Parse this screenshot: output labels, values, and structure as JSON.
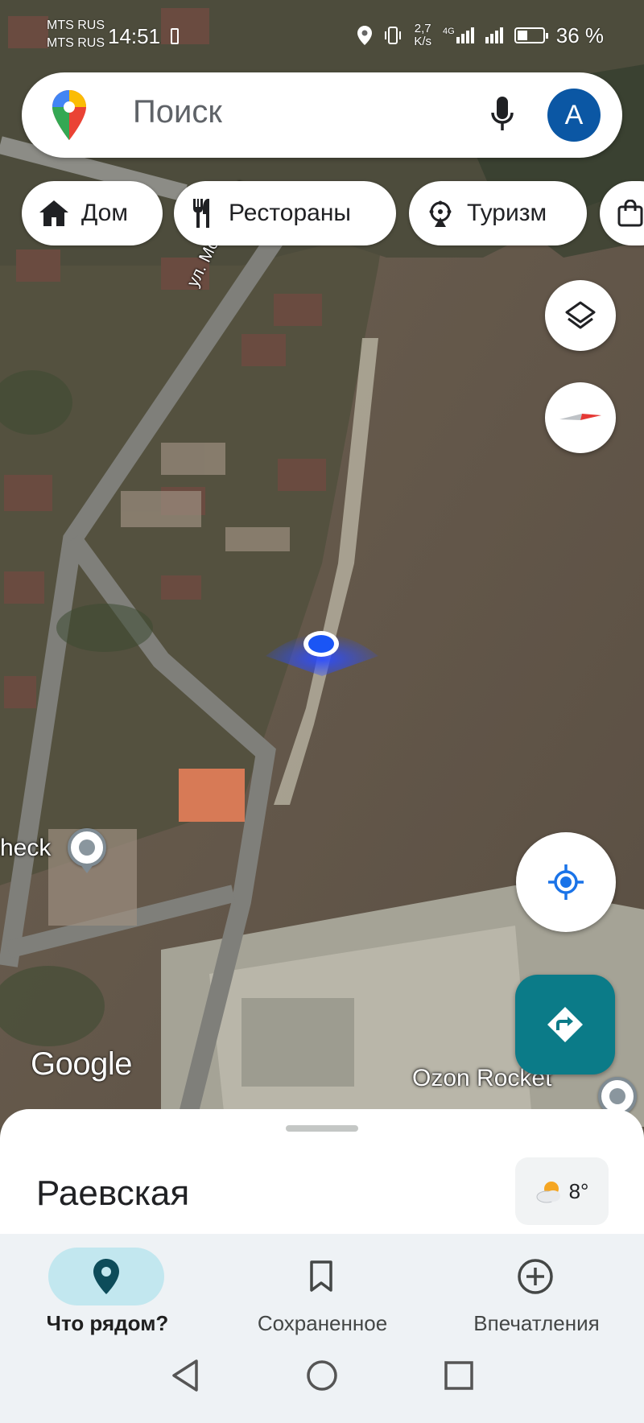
{
  "status_bar": {
    "carrier1": "MTS RUS",
    "carrier2": "MTS RUS",
    "time": "14:51",
    "net_speed_value": "2,7",
    "net_speed_unit": "K/s",
    "network_type": "4G",
    "battery": "36 %"
  },
  "search": {
    "placeholder": "Поиск",
    "avatar_letter": "A"
  },
  "chips": [
    {
      "label": "Дом",
      "icon": "home-icon"
    },
    {
      "label": "Рестораны",
      "icon": "restaurant-icon"
    },
    {
      "label": "Туризм",
      "icon": "attraction-icon"
    },
    {
      "label": "",
      "icon": "shopping-icon"
    }
  ],
  "map": {
    "street_name": "ул. Можайская",
    "poi_left": "heck",
    "poi_right": "Ozon Rocket",
    "attribution": "Google"
  },
  "sheet": {
    "place_name": "Раевская",
    "temperature": "8°",
    "weather_icon": "partly-cloudy-icon"
  },
  "bottom_nav": [
    {
      "label": "Что рядом?",
      "icon": "location-pin-icon",
      "active": true
    },
    {
      "label": "Сохраненное",
      "icon": "bookmark-icon",
      "active": false
    },
    {
      "label": "Впечатления",
      "icon": "add-circle-icon",
      "active": false
    }
  ],
  "colors": {
    "accent_blue": "#1a73e8",
    "avatar_bg": "#0b57a4",
    "directions_bg": "#0b7b88",
    "active_nav_pill": "#c2e7ef"
  }
}
